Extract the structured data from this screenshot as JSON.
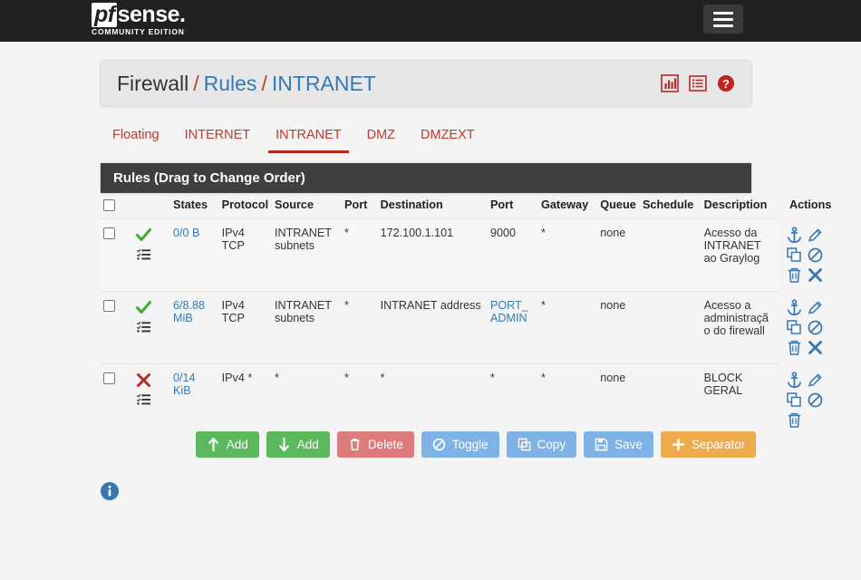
{
  "navbar": {
    "brand_pf": "pf",
    "brand_sense": "sense.",
    "brand_subtitle": "COMMUNITY EDITION",
    "menu_icon": "hamburger-icon"
  },
  "breadcrumb": {
    "root": "Firewall",
    "sep": "/",
    "level2": "Rules",
    "level3": "INTRANET",
    "icons": [
      "chart-bar-icon",
      "log-list-icon",
      "help-circle-icon"
    ]
  },
  "tabs": [
    {
      "label": "Floating",
      "active": false
    },
    {
      "label": "INTERNET",
      "active": false
    },
    {
      "label": "INTRANET",
      "active": true
    },
    {
      "label": "DMZ",
      "active": false
    },
    {
      "label": "DMZEXT",
      "active": false
    }
  ],
  "panel": {
    "title": "Rules (Drag to Change Order)"
  },
  "table": {
    "headers": {
      "checkbox": "",
      "states": "States",
      "protocol": "Protocol",
      "source": "Source",
      "src_port": "Port",
      "destination": "Destination",
      "dst_port": "Port",
      "gateway": "Gateway",
      "queue": "Queue",
      "schedule": "Schedule",
      "description": "Description",
      "actions": "Actions"
    },
    "rows": [
      {
        "action_icon": "green-check-icon",
        "states": "0/0 B",
        "protocol": "IPv4 TCP",
        "source": "INTRANET subnets",
        "src_port": "*",
        "destination": "172.100.1.101",
        "dst_port": "9000",
        "dst_port_link": false,
        "gateway": "*",
        "queue": "none",
        "schedule": "",
        "description": "Acesso da INTRANET ao Graylog",
        "actions": [
          "anchor-icon",
          "edit-pencil-icon",
          "copy-icon",
          "disable-icon",
          "delete-trash-icon",
          "remove-x-icon"
        ],
        "highlight": true
      },
      {
        "action_icon": "green-check-icon",
        "states": "6/8.88 MiB",
        "protocol": "IPv4 TCP",
        "source": "INTRANET subnets",
        "src_port": "*",
        "destination": "INTRANET address",
        "dst_port": "PORT_ADMIN",
        "dst_port_link": true,
        "gateway": "*",
        "queue": "none",
        "schedule": "",
        "description": "Acesso a administração do firewall",
        "actions": [
          "anchor-icon",
          "edit-pencil-icon",
          "copy-icon",
          "disable-icon",
          "delete-trash-icon",
          "remove-x-icon"
        ],
        "highlight": false
      },
      {
        "action_icon": "red-x-icon",
        "states": "0/14 KiB",
        "protocol": "IPv4 *",
        "source": "*",
        "src_port": "*",
        "destination": "*",
        "dst_port": "*",
        "dst_port_link": false,
        "gateway": "*",
        "queue": "none",
        "schedule": "",
        "description": "BLOCK GERAL",
        "actions": [
          "anchor-icon",
          "edit-pencil-icon",
          "copy-icon",
          "disable-icon",
          "delete-trash-icon"
        ],
        "highlight": false
      }
    ]
  },
  "buttons": [
    {
      "label": "Add",
      "icon": "arrow-up-icon",
      "color": "green"
    },
    {
      "label": "Add",
      "icon": "arrow-down-icon",
      "color": "green"
    },
    {
      "label": "Delete",
      "icon": "trash-icon",
      "color": "red"
    },
    {
      "label": "Toggle",
      "icon": "ban-icon",
      "color": "blue"
    },
    {
      "label": "Copy",
      "icon": "copy-icon",
      "color": "blue"
    },
    {
      "label": "Save",
      "icon": "save-disk-icon",
      "color": "blue"
    },
    {
      "label": "Separator",
      "icon": "plus-icon",
      "color": "orange"
    }
  ],
  "footer": {
    "info_icon": "info-circle-icon"
  },
  "colors": {
    "navbar_bg": "#212121",
    "page_bg": "#f4f4f4",
    "panel_head_bg": "#3f3f3f",
    "tab_red": "#c0392b",
    "link_blue": "#337ab7",
    "pass_green": "#3ea93e",
    "block_red": "#b52b27",
    "icon_blue": "#3b76b0"
  }
}
